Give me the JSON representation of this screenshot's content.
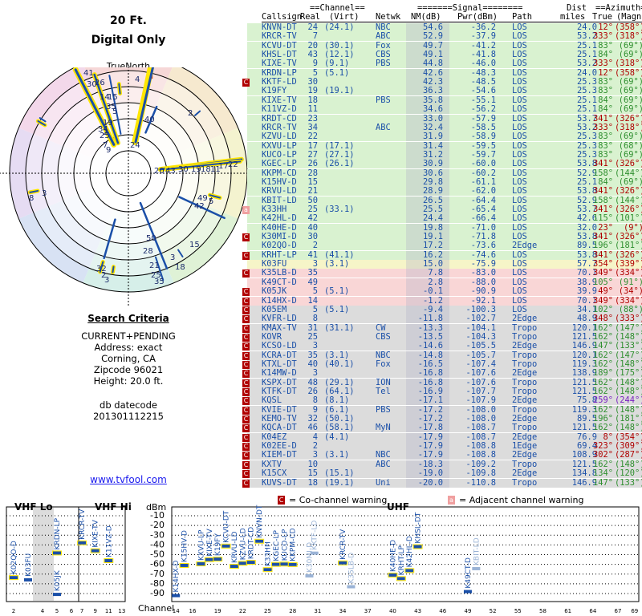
{
  "header": {
    "height": "20 Ft.",
    "mode": "Digital Only",
    "north": "TrueNorth",
    "north_letter": "N"
  },
  "criteria": {
    "title": "Search Criteria",
    "lines": [
      "CURRENT+PENDING",
      "Address: exact",
      "Corning, CA",
      "Zipcode 96021",
      "Height: 20.0 ft."
    ],
    "db_label": "db datecode",
    "db_value": "201301112215",
    "link": "www.tvfool.com"
  },
  "table_header": {
    "top": [
      "==Channel==",
      "=======Signal========",
      "Dist",
      "==Azimuth=="
    ],
    "cols": [
      "Callsign",
      "Real",
      "(Virt)",
      "Netwk",
      "NM(dB)",
      "Pwr(dBm)",
      "Path",
      "miles",
      "True",
      "(Magn)"
    ]
  },
  "colors": {
    "green": "#d9f2d0",
    "yellow": "#f6f5c8",
    "red": "#f9d6d6",
    "gray": "#dcdcdc",
    "blue": "#1a4fa8",
    "warn": "#b00000",
    "warn_adj": "#f0a0a0"
  },
  "rows": [
    [
      "KNVN-DT",
      "24",
      "(24.1)",
      "NBC",
      "54.6",
      "-36.2",
      "LOS",
      "24.0",
      "12°",
      "(358°)",
      "g",
      ""
    ],
    [
      "KRCR-TV",
      "7",
      "",
      "ABC",
      "52.9",
      "-37.9",
      "LOS",
      "53.2",
      "333°",
      "(318°)",
      "g",
      ""
    ],
    [
      "KCVU-DT",
      "20",
      "(30.1)",
      "Fox",
      "49.7",
      "-41.2",
      "LOS",
      "25.1",
      "83°",
      "(69°)",
      "g",
      ""
    ],
    [
      "KHSL-DT",
      "43",
      "(12.1)",
      "CBS",
      "49.1",
      "-41.8",
      "LOS",
      "25.1",
      "84°",
      "(69°)",
      "g",
      ""
    ],
    [
      "KIXE-TV",
      "9",
      "(9.1)",
      "PBS",
      "44.8",
      "-46.0",
      "LOS",
      "53.2",
      "333°",
      "(318°)",
      "g",
      ""
    ],
    [
      "KRDN-LP",
      "5",
      "(5.1)",
      "",
      "42.6",
      "-48.3",
      "LOS",
      "24.0",
      "12°",
      "(358°)",
      "g",
      ""
    ],
    [
      "KKTF-LD",
      "30",
      "",
      "",
      "42.3",
      "-48.5",
      "LOS",
      "25.3",
      "83°",
      "(69°)",
      "g",
      "C"
    ],
    [
      "K19FY",
      "19",
      "(19.1)",
      "",
      "36.3",
      "-54.6",
      "LOS",
      "25.3",
      "83°",
      "(69°)",
      "g",
      ""
    ],
    [
      "KIXE-TV",
      "18",
      "",
      "PBS",
      "35.8",
      "-55.1",
      "LOS",
      "25.1",
      "84°",
      "(69°)",
      "g",
      ""
    ],
    [
      "K11VZ-D",
      "11",
      "",
      "",
      "34.6",
      "-56.2",
      "LOS",
      "25.1",
      "84°",
      "(69°)",
      "g",
      ""
    ],
    [
      "KRDT-CD",
      "23",
      "",
      "",
      "33.0",
      "-57.9",
      "LOS",
      "53.7",
      "341°",
      "(326°)",
      "g",
      ""
    ],
    [
      "KRCR-TV",
      "34",
      "",
      "ABC",
      "32.4",
      "-58.5",
      "LOS",
      "53.2",
      "333°",
      "(318°)",
      "g",
      ""
    ],
    [
      "KZVU-LD",
      "22",
      "",
      "",
      "31.9",
      "-58.9",
      "LOS",
      "25.3",
      "83°",
      "(69°)",
      "g",
      ""
    ],
    [
      "KXVU-LP",
      "17",
      "(17.1)",
      "",
      "31.4",
      "-59.5",
      "LOS",
      "25.3",
      "83°",
      "(68°)",
      "g",
      ""
    ],
    [
      "KUCO-LP",
      "27",
      "(27.1)",
      "",
      "31.2",
      "-59.7",
      "LOS",
      "25.3",
      "83°",
      "(69°)",
      "g",
      ""
    ],
    [
      "KGEC-LP",
      "26",
      "(26.1)",
      "",
      "30.9",
      "-60.0",
      "LOS",
      "53.8",
      "341°",
      "(326°)",
      "g",
      ""
    ],
    [
      "KKPM-CD",
      "28",
      "",
      "",
      "30.6",
      "-60.2",
      "LOS",
      "52.9",
      "158°",
      "(144°)",
      "g",
      ""
    ],
    [
      "K15HV-D",
      "15",
      "",
      "",
      "29.8",
      "-61.1",
      "LOS",
      "25.1",
      "84°",
      "(69°)",
      "g",
      ""
    ],
    [
      "KRVU-LD",
      "21",
      "",
      "",
      "28.9",
      "-62.0",
      "LOS",
      "53.8",
      "341°",
      "(326°)",
      "g",
      ""
    ],
    [
      "KBIT-LD",
      "50",
      "",
      "",
      "26.5",
      "-64.4",
      "LOS",
      "52.9",
      "158°",
      "(144°)",
      "g",
      ""
    ],
    [
      "K33HH",
      "25",
      "(33.1)",
      "",
      "25.5",
      "-65.4",
      "LOS",
      "53.7",
      "341°",
      "(326°)",
      "g",
      "a"
    ],
    [
      "K42HL-D",
      "42",
      "",
      "",
      "24.4",
      "-66.4",
      "LOS",
      "42.6",
      "115°",
      "(101°)",
      "g",
      ""
    ],
    [
      "K40HE-D",
      "40",
      "",
      "",
      "19.8",
      "-71.0",
      "LOS",
      "32.0",
      "23°",
      "(9°)",
      "g",
      ""
    ],
    [
      "K30MI-D",
      "30",
      "",
      "",
      "19.1",
      "-71.8",
      "LOS",
      "53.8",
      "341°",
      "(326°)",
      "g",
      "C"
    ],
    [
      "K02QO-D",
      "2",
      "",
      "",
      "17.2",
      "-73.6",
      "2Edge",
      "89.5",
      "196°",
      "(181°)",
      "g",
      ""
    ],
    [
      "KRHT-LP",
      "41",
      "(41.1)",
      "",
      "16.2",
      "-74.6",
      "LOS",
      "53.8",
      "341°",
      "(326°)",
      "g",
      "C"
    ],
    [
      "K03FU",
      "3",
      "(3.1)",
      "",
      "15.0",
      "-75.9",
      "LOS",
      "57.7",
      "354°",
      "(339°)",
      "y",
      ""
    ],
    [
      "K35LB-D",
      "35",
      "",
      "",
      "7.8",
      "-83.0",
      "LOS",
      "70.1",
      "349°",
      "(334°)",
      "r",
      "Ca"
    ],
    [
      "K49CT-D",
      "49",
      "",
      "",
      "2.8",
      "-88.0",
      "LOS",
      "38.9",
      "105°",
      "(91°)",
      "r",
      ""
    ],
    [
      "K05JK",
      "5",
      "(5.1)",
      "",
      "-0.1",
      "-90.9",
      "LOS",
      "39.9",
      "49°",
      "(34°)",
      "r",
      "Ca"
    ],
    [
      "K14HX-D",
      "14",
      "",
      "",
      "-1.2",
      "-92.1",
      "LOS",
      "70.1",
      "349°",
      "(334°)",
      "r",
      "C"
    ],
    [
      "K05EM",
      "5",
      "(5.1)",
      "",
      "-9.4",
      "-100.3",
      "LOS",
      "34.1",
      "102°",
      "(88°)",
      "x",
      "aC"
    ],
    [
      "KVFR-LD",
      "8",
      "",
      "",
      "-11.8",
      "-102.7",
      "2Edge",
      "48.9",
      "348°",
      "(333°)",
      "x",
      "aC"
    ],
    [
      "KMAX-TV",
      "31",
      "(31.1)",
      "CW",
      "-13.3",
      "-104.1",
      "Tropo",
      "120.1",
      "162°",
      "(147°)",
      "x",
      "aC"
    ],
    [
      "KOVR",
      "25",
      "",
      "CBS",
      "-13.5",
      "-104.3",
      "Tropo",
      "121.5",
      "162°",
      "(148°)",
      "x",
      "aC"
    ],
    [
      "KCSO-LD",
      "3",
      "",
      "",
      "-14.6",
      "-105.5",
      "2Edge",
      "146.9",
      "147°",
      "(133°)",
      "x",
      "aC"
    ],
    [
      "KCRA-DT",
      "35",
      "(3.1)",
      "NBC",
      "-14.8",
      "-105.7",
      "Tropo",
      "120.1",
      "162°",
      "(147°)",
      "x",
      "aC"
    ],
    [
      "KTXL-DT",
      "40",
      "(40.1)",
      "Fox",
      "-16.5",
      "-107.4",
      "Tropo",
      "119.3",
      "162°",
      "(148°)",
      "x",
      "aC"
    ],
    [
      "K14MW-D",
      "3",
      "",
      "",
      "-16.8",
      "-107.6",
      "2Edge",
      "138.9",
      "189°",
      "(175°)",
      "x",
      "aC"
    ],
    [
      "KSPX-DT",
      "48",
      "(29.1)",
      "ION",
      "-16.8",
      "-107.6",
      "Tropo",
      "121.5",
      "162°",
      "(148°)",
      "x",
      "aC"
    ],
    [
      "KTFK-DT",
      "26",
      "(64.1)",
      "Tel",
      "-16.9",
      "-107.7",
      "Tropo",
      "121.5",
      "162°",
      "(148°)",
      "x",
      "aC"
    ],
    [
      "KQSL",
      "8",
      "(8.1)",
      "",
      "-17.1",
      "-107.9",
      "2Edge",
      "75.8",
      "259°",
      "(244°)",
      "x",
      "aC"
    ],
    [
      "KVIE-DT",
      "9",
      "(6.1)",
      "PBS",
      "-17.2",
      "-108.0",
      "Tropo",
      "119.3",
      "162°",
      "(148°)",
      "x",
      "aC"
    ],
    [
      "KEMO-TV",
      "32",
      "(50.1)",
      "",
      "-17.2",
      "-108.0",
      "2Edge",
      "89.5",
      "196°",
      "(181°)",
      "x",
      "aC"
    ],
    [
      "KQCA-DT",
      "46",
      "(58.1)",
      "MyN",
      "-17.8",
      "-108.7",
      "Tropo",
      "121.5",
      "162°",
      "(148°)",
      "x",
      "aC"
    ],
    [
      "K04EZ",
      "4",
      "(4.1)",
      "",
      "-17.9",
      "-108.7",
      "2Edge",
      "76.9",
      "8°",
      "(354°)",
      "x",
      "aC"
    ],
    [
      "K02EE-D",
      "2",
      "",
      "",
      "-17.9",
      "-108.8",
      "1Edge",
      "69.4",
      "323°",
      "(309°)",
      "x",
      "aC"
    ],
    [
      "KIEM-DT",
      "3",
      "(3.1)",
      "NBC",
      "-17.9",
      "-108.8",
      "2Edge",
      "108.9",
      "302°",
      "(287°)",
      "x",
      "aC"
    ],
    [
      "KXTV",
      "10",
      "",
      "ABC",
      "-18.3",
      "-109.2",
      "Tropo",
      "121.5",
      "162°",
      "(148°)",
      "x",
      "aC"
    ],
    [
      "K15CX",
      "15",
      "(15.1)",
      "",
      "-19.0",
      "-109.8",
      "2Edge",
      "134.8",
      "134°",
      "(120°)",
      "x",
      "aC"
    ],
    [
      "KUVS-DT",
      "18",
      "(19.1)",
      "Uni",
      "-20.0",
      "-110.8",
      "Tropo",
      "146.9",
      "147°",
      "(133°)",
      "x",
      "aC"
    ]
  ],
  "legend": {
    "co": "= Co-channel warning",
    "adj": "= Adjacent channel warning",
    "co_letter": "C",
    "adj_letter": "a"
  },
  "bottom": {
    "vhflo": "VHF Lo",
    "vhfhi": "VHF Hi",
    "uhf": "UHF",
    "dbm": "dBm",
    "channel": "Channel",
    "yticks": [
      "-10",
      "-20",
      "-30",
      "-40",
      "-50",
      "-60",
      "-70",
      "-80",
      "-90"
    ],
    "lo_ticks": [
      "2",
      "4",
      "5",
      "6"
    ],
    "hi_ticks": [
      "7",
      "9",
      "11",
      "13"
    ],
    "uhf_ticks": [
      "14",
      "16",
      "19",
      "22",
      "25",
      "28",
      "31",
      "34",
      "37",
      "40",
      "43",
      "46",
      "49",
      "52",
      "55",
      "58",
      "61",
      "64",
      "67",
      "69"
    ]
  },
  "spectrum": [
    {
      "ch": 2,
      "pwr": -73.6,
      "label": "K02QO-D",
      "c": "g"
    },
    {
      "ch": 3,
      "pwr": -75.9,
      "label": "K03FU",
      "c": "y"
    },
    {
      "ch": 5,
      "pwr": -48.3,
      "label": "KRDN-LP",
      "c": "g"
    },
    {
      "ch": 5,
      "pwr": -90.9,
      "label": "K05JK",
      "c": "r"
    },
    {
      "ch": 7,
      "pwr": -37.9,
      "label": "KRCR-TV",
      "c": "g"
    },
    {
      "ch": 9,
      "pwr": -46.0,
      "label": "KIXE-TV",
      "c": "g"
    },
    {
      "ch": 11,
      "pwr": -56.2,
      "label": "K11VZ-D",
      "c": "g"
    },
    {
      "ch": 14,
      "pwr": -92.1,
      "label": "K14HX-D",
      "c": "r"
    },
    {
      "ch": 15,
      "pwr": -61.1,
      "label": "K15HV-D",
      "c": "g"
    },
    {
      "ch": 17,
      "pwr": -59.5,
      "label": "KXVU-LP",
      "c": "g"
    },
    {
      "ch": 18,
      "pwr": -55.1,
      "label": "KIXE-TV",
      "c": "g"
    },
    {
      "ch": 19,
      "pwr": -54.6,
      "label": "K19FY",
      "c": "g"
    },
    {
      "ch": 20,
      "pwr": -41.2,
      "label": "KCVU-DT",
      "c": "g"
    },
    {
      "ch": 21,
      "pwr": -62.0,
      "label": "KRVU-LD",
      "c": "g"
    },
    {
      "ch": 22,
      "pwr": -58.9,
      "label": "KZVU-LD",
      "c": "g"
    },
    {
      "ch": 23,
      "pwr": -57.9,
      "label": "KRDT-CD",
      "c": "g"
    },
    {
      "ch": 24,
      "pwr": -36.2,
      "label": "KNVN-DT",
      "c": "g"
    },
    {
      "ch": 25,
      "pwr": -65.4,
      "label": "K33HH",
      "c": "g"
    },
    {
      "ch": 26,
      "pwr": -60.0,
      "label": "KGEC-LP",
      "c": "g"
    },
    {
      "ch": 27,
      "pwr": -59.7,
      "label": "KUCO-LP",
      "c": "g"
    },
    {
      "ch": 28,
      "pwr": -60.2,
      "label": "KKPM-CD",
      "c": "g"
    },
    {
      "ch": 30,
      "pwr": -71.8,
      "label": "K30MI-D",
      "c": "f"
    },
    {
      "ch": 30.6,
      "pwr": -48.5,
      "label": "KKTF-LD",
      "c": "f"
    },
    {
      "ch": 34,
      "pwr": -58.5,
      "label": "KRCR-TV",
      "c": "g"
    },
    {
      "ch": 35,
      "pwr": -83.0,
      "label": "K35LB-D",
      "c": "f"
    },
    {
      "ch": 40,
      "pwr": -71.0,
      "label": "K40HE-D",
      "c": "g"
    },
    {
      "ch": 41,
      "pwr": -74.6,
      "label": "KRHT-LP",
      "c": "g"
    },
    {
      "ch": 42,
      "pwr": -66.4,
      "label": "K42HL-D",
      "c": "g"
    },
    {
      "ch": 43,
      "pwr": -41.8,
      "label": "KHSL-DT",
      "c": "g"
    },
    {
      "ch": 49,
      "pwr": -88.0,
      "label": "K49CT-D",
      "c": "r"
    },
    {
      "ch": 50,
      "pwr": -64.4,
      "label": "KBIT-LD",
      "c": "f"
    }
  ],
  "polar_labels": [
    "41",
    "30",
    "26",
    "14",
    "15",
    "35",
    "5",
    "4",
    "24",
    "40",
    "2",
    "3",
    "34",
    "2",
    "25",
    "19",
    "9",
    "7",
    "20",
    "43",
    "30",
    "19",
    "18",
    "11",
    "17",
    "22",
    "8",
    "49",
    "5",
    "42",
    "28",
    "50",
    "21",
    "25",
    "15",
    "3",
    "18",
    "32",
    "2",
    "3",
    "35"
  ]
}
